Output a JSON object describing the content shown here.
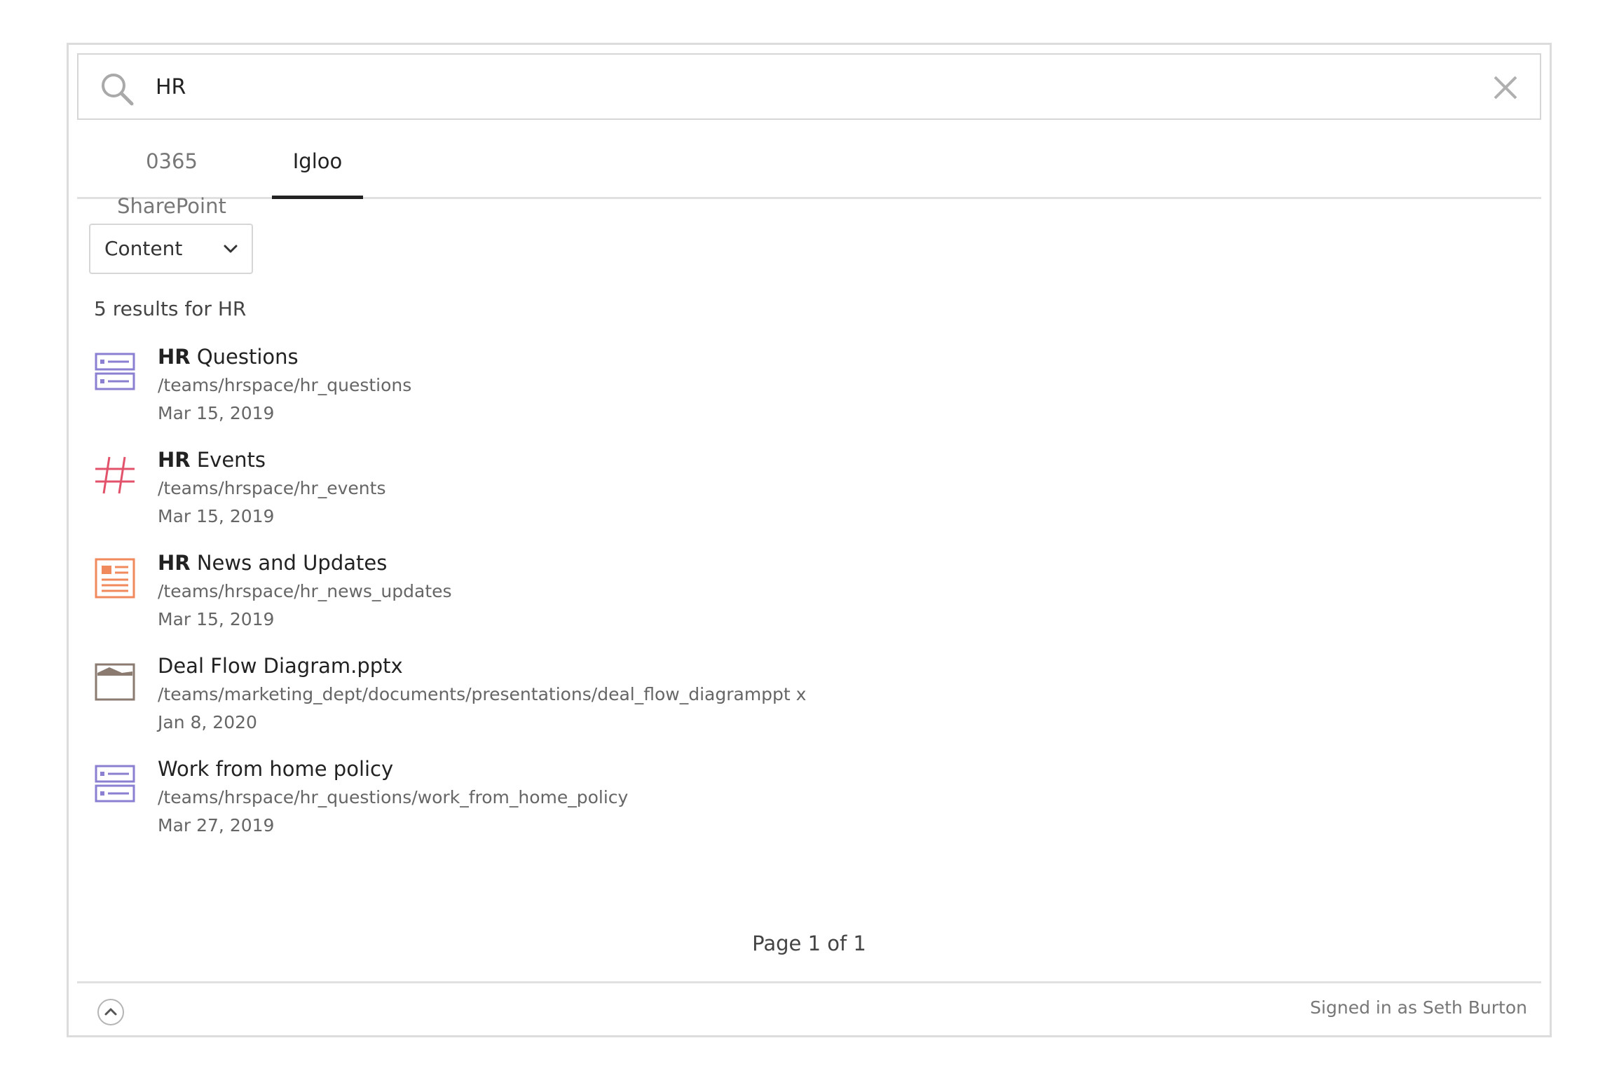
{
  "search": {
    "value": "HR",
    "placeholder": ""
  },
  "tabs": [
    {
      "label": "0365 SharePoint",
      "active": false
    },
    {
      "label": "Igloo",
      "active": true
    }
  ],
  "filter": {
    "selected": "Content"
  },
  "results_summary": "5 results for HR",
  "results": [
    {
      "icon": "forum-icon",
      "icon_color": "#8a7fd0",
      "title_bold": "HR",
      "title_rest": " Questions",
      "path": "/teams/hrspace/hr_questions",
      "date": "Mar 15, 2019"
    },
    {
      "icon": "hashtag-icon",
      "icon_color": "#e2536b",
      "title_bold": "HR",
      "title_rest": " Events",
      "path": "/teams/hrspace/hr_events",
      "date": "Mar 15, 2019"
    },
    {
      "icon": "news-icon",
      "icon_color": "#f08a5d",
      "title_bold": "HR",
      "title_rest": " News and Updates",
      "path": "/teams/hrspace/hr_news_updates",
      "date": "Mar 15, 2019"
    },
    {
      "icon": "folder-icon",
      "icon_color": "#8a7a70",
      "title_bold": "",
      "title_rest": "Deal Flow Diagram.pptx",
      "path": "/teams/marketing_dept/documents/presentations/deal_flow_diagramppt x",
      "date": "Jan 8, 2020"
    },
    {
      "icon": "forum-icon",
      "icon_color": "#8a7fd0",
      "title_bold": "",
      "title_rest": "Work from home policy",
      "path": "/teams/hrspace/hr_questions/work_from_home_policy",
      "date": "Mar 27, 2019"
    }
  ],
  "pager": "Page 1 of 1",
  "footer": {
    "signed_in": "Signed in as Seth Burton"
  }
}
